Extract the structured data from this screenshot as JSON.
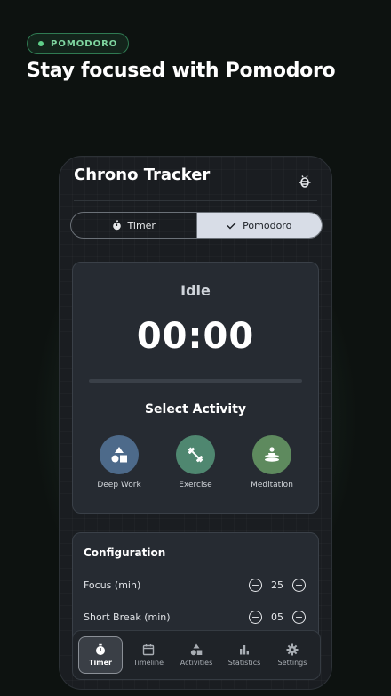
{
  "promo": {
    "badge": "POMODORO",
    "headline": "Stay focused with Pomodoro"
  },
  "app": {
    "title": "Chrono Tracker",
    "debug_icon": "bug-icon"
  },
  "mode_toggle": {
    "timer_label": "Timer",
    "pomodoro_label": "Pomodoro",
    "selected": "Pomodoro"
  },
  "timer": {
    "status": "Idle",
    "time": "00:00",
    "progress": 0
  },
  "activities": {
    "title": "Select Activity",
    "items": [
      {
        "label": "Deep Work",
        "icon": "shapes-icon",
        "color": "#4d6a8a"
      },
      {
        "label": "Exercise",
        "icon": "dumbbell-icon",
        "color": "#4f8770"
      },
      {
        "label": "Meditation",
        "icon": "meditation-icon",
        "color": "#5e8a5e"
      }
    ]
  },
  "configuration": {
    "title": "Configuration",
    "rows": [
      {
        "label": "Focus (min)",
        "value": "25"
      },
      {
        "label": "Short Break (min)",
        "value": "05"
      }
    ]
  },
  "nav": {
    "items": [
      {
        "label": "Timer",
        "icon": "stopwatch-icon",
        "active": true
      },
      {
        "label": "Timeline",
        "icon": "calendar-icon",
        "active": false
      },
      {
        "label": "Activities",
        "icon": "shapes-icon",
        "active": false
      },
      {
        "label": "Statistics",
        "icon": "bar-chart-icon",
        "active": false
      },
      {
        "label": "Settings",
        "icon": "gear-icon",
        "active": false
      }
    ]
  },
  "colors": {
    "accent_green": "#5fd08a",
    "selected_segment": "#d8dde7",
    "card_bg": "#262b32"
  }
}
